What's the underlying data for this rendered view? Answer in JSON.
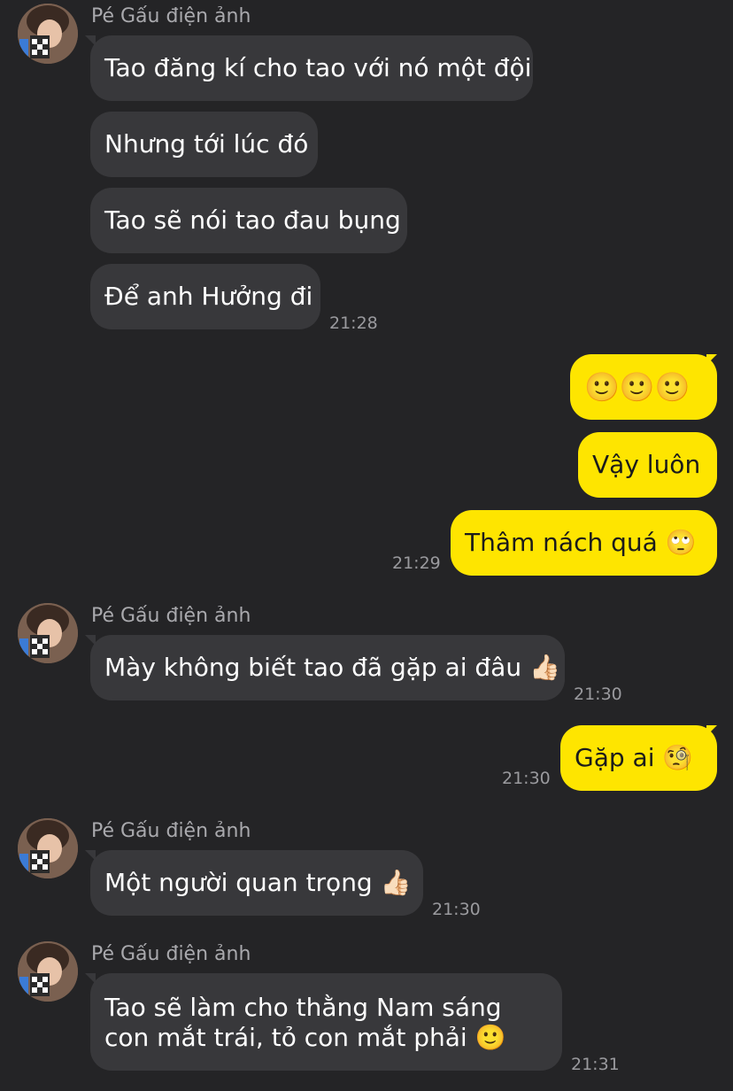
{
  "sender_name": "Pé Gấu điện ảnh",
  "messages": [
    {
      "text": "Tao đăng kí cho tao với nó một đội"
    },
    {
      "text": "Nhưng tới lúc đó"
    },
    {
      "text": "Tao sẽ nói tao đau bụng"
    },
    {
      "text": "Để anh Hưởng đi",
      "time": "21:28"
    },
    {
      "text": "🙂🙂🙂"
    },
    {
      "text": "Vậy luôn"
    },
    {
      "text": "Thâm nách quá",
      "emoji": "🙄",
      "time": "21:29"
    },
    {
      "text": "Mày không biết tao đã gặp ai đâu",
      "emoji": "👍🏻",
      "time": "21:30"
    },
    {
      "text": "Gặp ai",
      "emoji": "🧐",
      "time": "21:30"
    },
    {
      "text": "Một người quan trọng",
      "emoji": "👍🏻",
      "time": "21:30"
    },
    {
      "text": "Tao sẽ làm cho thằng Nam sáng con mắt trái, tỏ con mắt phải",
      "emoji": "🙂",
      "time": "21:31"
    }
  ],
  "colors": {
    "background": "#242426",
    "incoming_bubble": "#38383b",
    "outgoing_bubble": "#fee500",
    "timestamp": "#9a9a9e"
  }
}
